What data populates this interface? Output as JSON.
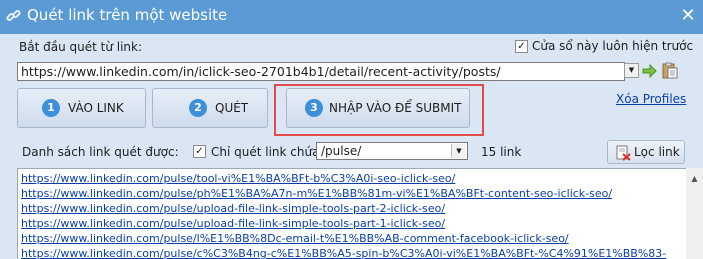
{
  "window": {
    "title": "Quét link trên một website",
    "close_symbol": "✕"
  },
  "start_label": "Bắt đầu quét từ link:",
  "always_on_top": {
    "label": "Cửa sổ này luôn hiện trước",
    "checked": true
  },
  "url_input": {
    "value": "https://www.linkedin.com/in/iclick-seo-2701b4b1/detail/recent-activity/posts/"
  },
  "steps": [
    {
      "num": "1",
      "label": "VÀO LINK"
    },
    {
      "num": "2",
      "label": "QUÉT"
    },
    {
      "num": "3",
      "label": "NHẬP VÀO ĐỂ SUBMIT"
    }
  ],
  "clear_profiles": "Xóa Profiles",
  "scanned_label": "Danh sách link quét được:",
  "only_scan": {
    "label": "Chỉ quét link chứa",
    "checked": true
  },
  "filter": {
    "value": "/pulse/"
  },
  "link_count": "15 link",
  "filter_button": "Lọc link",
  "links": [
    "https://www.linkedin.com/pulse/tool-vi%E1%BA%BFt-b%C3%A0i-seo-iclick-seo/",
    "https://www.linkedin.com/pulse/ph%E1%BA%A7n-m%E1%BB%81m-vi%E1%BA%BFt-content-seo-iclick-seo/",
    "https://www.linkedin.com/pulse/upload-file-link-simple-tools-part-2-iclick-seo/",
    "https://www.linkedin.com/pulse/upload-file-link-simple-tools-part-1-iclick-seo/",
    "https://www.linkedin.com/pulse/l%E1%BB%8Dc-email-t%E1%BB%AB-comment-facebook-iclick-seo/",
    "https://www.linkedin.com/pulse/c%C3%B4ng-c%E1%BB%A5-spin-b%C3%A0i-vi%E1%BA%BFt-%C4%91%E1%BB%83-"
  ],
  "colors": {
    "titlebar": "#5b9bd5",
    "background": "#dae6f4",
    "highlight": "#e14b4b",
    "link": "#0b3fa8",
    "step_badge": "#3d8fd9"
  }
}
